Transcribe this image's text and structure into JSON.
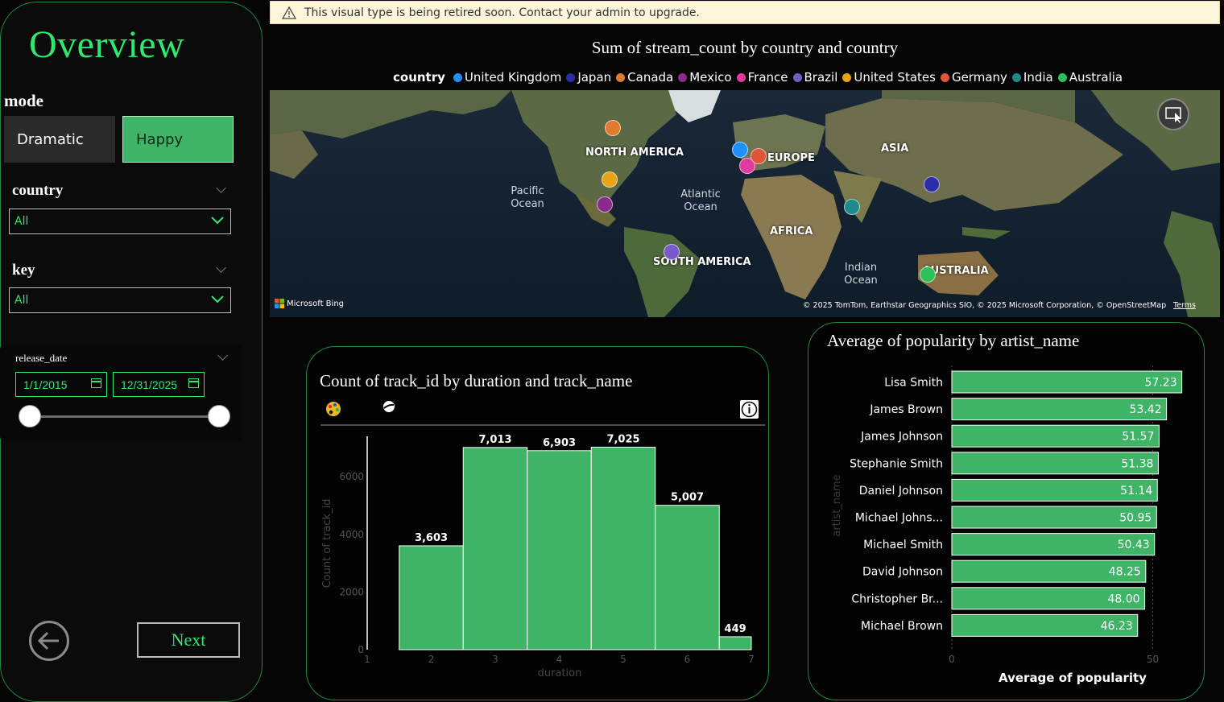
{
  "sidebar": {
    "title": "Overview",
    "mode_label": "mode",
    "mode_options": [
      "Dramatic",
      "Happy"
    ],
    "mode_selected": "Happy",
    "country_label": "country",
    "country_value": "All",
    "key_label": "key",
    "key_value": "All",
    "release_label": "release_date",
    "date_start": "1/1/2015",
    "date_end": "12/31/2025",
    "next_label": "Next"
  },
  "banner": {
    "text": "This visual type is being retired soon. Contact your admin to upgrade."
  },
  "map": {
    "title": "Sum of stream_count by country and country",
    "legend_title": "country",
    "legend": [
      {
        "name": "United Kingdom",
        "color": "#1e90ff"
      },
      {
        "name": "Japan",
        "color": "#2a2fa8"
      },
      {
        "name": "Canada",
        "color": "#e07a2e"
      },
      {
        "name": "Mexico",
        "color": "#8a2a8a"
      },
      {
        "name": "France",
        "color": "#e03aa0"
      },
      {
        "name": "Brazil",
        "color": "#7a5ac8"
      },
      {
        "name": "United States",
        "color": "#e8a317"
      },
      {
        "name": "Germany",
        "color": "#e0553a"
      },
      {
        "name": "India",
        "color": "#1f8a8a"
      },
      {
        "name": "Australia",
        "color": "#2ebf5a"
      }
    ],
    "region_labels": [
      "NORTH AMERICA",
      "EUROPE",
      "ASIA",
      "AFRICA",
      "SOUTH AMERICA",
      "AUSTRALIA"
    ],
    "ocean_labels": [
      "Pacific Ocean",
      "Atlantic Ocean",
      "Indian Ocean"
    ],
    "brand": "Microsoft Bing",
    "copyright": "© 2025 TomTom, Earthstar Geographics SIO, © 2025 Microsoft Corporation, © OpenStreetMap",
    "terms": "Terms"
  },
  "histogram": {
    "title": "Count of track_id by duration and track_name"
  },
  "bars_card": {
    "title": "Average of popularity by artist_name"
  },
  "chart_data": [
    {
      "type": "bar",
      "title": "Count of track_id by duration and track_name",
      "xlabel": "duration",
      "ylabel": "Count of track_id",
      "x": [
        1.5,
        2.5,
        3.5,
        4.5,
        5.5,
        6.5
      ],
      "categories": [
        "1.5-2.5",
        "2.5-3.5",
        "3.5-4.5",
        "4.5-5.5",
        "5.5-6.5",
        "6.5-7"
      ],
      "values": [
        3603,
        7013,
        6903,
        7025,
        5007,
        449
      ],
      "value_labels": [
        "3,603",
        "7,013",
        "6,903",
        "7,025",
        "5,007",
        "449"
      ],
      "x_ticks": [
        "1",
        "2",
        "3",
        "4",
        "5",
        "6",
        "7"
      ],
      "y_ticks": [
        "0",
        "2000",
        "4000",
        "6000"
      ],
      "xlim": [
        1,
        7
      ],
      "ylim": [
        0,
        7400
      ],
      "color": "#3fb466"
    },
    {
      "type": "bar",
      "orientation": "horizontal",
      "title": "Average of popularity by artist_name",
      "xlabel": "Average of popularity",
      "ylabel": "artist_name",
      "categories": [
        "Lisa Smith",
        "James Brown",
        "James Johnson",
        "Stephanie Smith",
        "Daniel Johnson",
        "Michael Johns...",
        "Michael Smith",
        "David Johnson",
        "Christopher Br...",
        "Michael Brown"
      ],
      "values": [
        57.23,
        53.42,
        51.57,
        51.38,
        51.14,
        50.95,
        50.43,
        48.25,
        48.0,
        46.23
      ],
      "value_labels": [
        "57.23",
        "53.42",
        "51.57",
        "51.38",
        "51.14",
        "50.95",
        "50.43",
        "48.25",
        "48.00",
        "46.23"
      ],
      "x_ticks": [
        "0",
        "50"
      ],
      "xlim": [
        0,
        57.3
      ],
      "color": "#3fb466"
    }
  ]
}
